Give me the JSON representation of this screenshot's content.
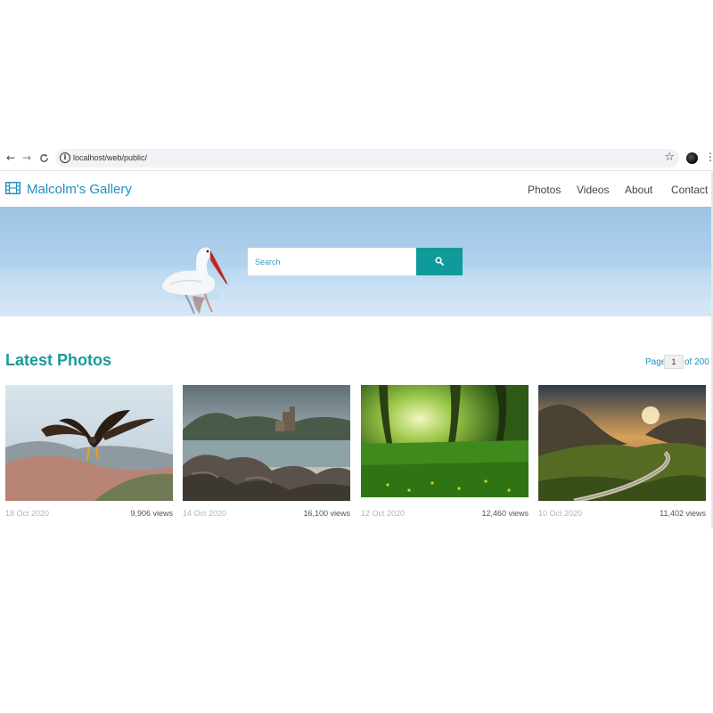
{
  "browser": {
    "url": "localhost/web/public/",
    "back_icon": "←",
    "forward_icon": "→",
    "reload_icon": "C",
    "info_icon": "i",
    "star_icon": "☆",
    "menu_icon": "⋮"
  },
  "site": {
    "brand": "Malcolm's Gallery",
    "nav": [
      "Photos",
      "Videos",
      "About",
      "Contact"
    ],
    "accent_color": "#119a9a",
    "brand_color": "#1f8fbf"
  },
  "hero": {
    "search_placeholder": "Search"
  },
  "latest": {
    "title": "Latest Photos",
    "pager": {
      "label": "Page",
      "current": "1",
      "total_label": "of 200"
    },
    "photos": [
      {
        "date": "18 Oct 2020",
        "views": "9,906 views",
        "subject": "eagle"
      },
      {
        "date": "14 Oct 2020",
        "views": "16,100 views",
        "subject": "castle-lake"
      },
      {
        "date": "12 Oct 2020",
        "views": "12,460 views",
        "subject": "forest-meadow"
      },
      {
        "date": "10 Oct 2020",
        "views": "11,402 views",
        "subject": "mountain-road"
      }
    ]
  }
}
